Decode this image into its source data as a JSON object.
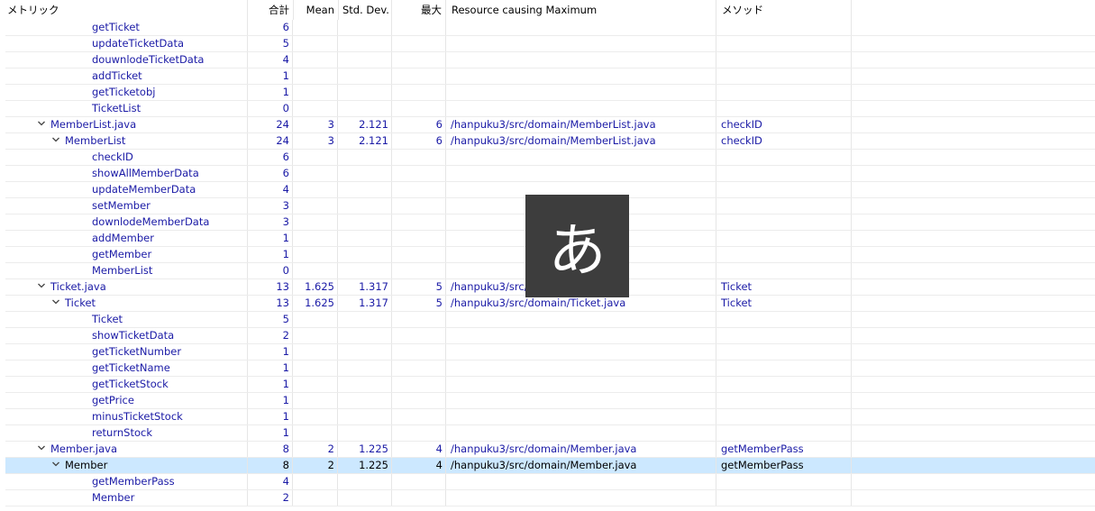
{
  "columns": {
    "metric": "メトリック",
    "total": "合計",
    "mean": "Mean",
    "stddev": "Std. Dev.",
    "max": "最大",
    "resource": "Resource causing Maximum",
    "method": "メソッド"
  },
  "rows": [
    {
      "name": "getTicket",
      "level": 3,
      "total": "6",
      "mean": "",
      "std": "",
      "max": "",
      "res": "",
      "method": "",
      "expand": ""
    },
    {
      "name": "updateTicketData",
      "level": 3,
      "total": "5",
      "mean": "",
      "std": "",
      "max": "",
      "res": "",
      "method": "",
      "expand": ""
    },
    {
      "name": "douwnlodeTicketData",
      "level": 3,
      "total": "4",
      "mean": "",
      "std": "",
      "max": "",
      "res": "",
      "method": "",
      "expand": ""
    },
    {
      "name": "addTicket",
      "level": 3,
      "total": "1",
      "mean": "",
      "std": "",
      "max": "",
      "res": "",
      "method": "",
      "expand": ""
    },
    {
      "name": "getTicketobj",
      "level": 3,
      "total": "1",
      "mean": "",
      "std": "",
      "max": "",
      "res": "",
      "method": "",
      "expand": ""
    },
    {
      "name": "TicketList",
      "level": 3,
      "total": "0",
      "mean": "",
      "std": "",
      "max": "",
      "res": "",
      "method": "",
      "expand": ""
    },
    {
      "name": "MemberList.java",
      "level": 1,
      "total": "24",
      "mean": "3",
      "std": "2.121",
      "max": "6",
      "res": "/hanpuku3/src/domain/MemberList.java",
      "method": "checkID",
      "expand": "open"
    },
    {
      "name": "MemberList",
      "level": 2,
      "total": "24",
      "mean": "3",
      "std": "2.121",
      "max": "6",
      "res": "/hanpuku3/src/domain/MemberList.java",
      "method": "checkID",
      "expand": "open"
    },
    {
      "name": "checkID",
      "level": 3,
      "total": "6",
      "mean": "",
      "std": "",
      "max": "",
      "res": "",
      "method": "",
      "expand": ""
    },
    {
      "name": "showAllMemberData",
      "level": 3,
      "total": "6",
      "mean": "",
      "std": "",
      "max": "",
      "res": "",
      "method": "",
      "expand": ""
    },
    {
      "name": "updateMemberData",
      "level": 3,
      "total": "4",
      "mean": "",
      "std": "",
      "max": "",
      "res": "",
      "method": "",
      "expand": ""
    },
    {
      "name": "setMember",
      "level": 3,
      "total": "3",
      "mean": "",
      "std": "",
      "max": "",
      "res": "",
      "method": "",
      "expand": ""
    },
    {
      "name": "downlodeMemberData",
      "level": 3,
      "total": "3",
      "mean": "",
      "std": "",
      "max": "",
      "res": "",
      "method": "",
      "expand": ""
    },
    {
      "name": "addMember",
      "level": 3,
      "total": "1",
      "mean": "",
      "std": "",
      "max": "",
      "res": "",
      "method": "",
      "expand": ""
    },
    {
      "name": "getMember",
      "level": 3,
      "total": "1",
      "mean": "",
      "std": "",
      "max": "",
      "res": "",
      "method": "",
      "expand": ""
    },
    {
      "name": "MemberList",
      "level": 3,
      "total": "0",
      "mean": "",
      "std": "",
      "max": "",
      "res": "",
      "method": "",
      "expand": ""
    },
    {
      "name": "Ticket.java",
      "level": 1,
      "total": "13",
      "mean": "1.625",
      "std": "1.317",
      "max": "5",
      "res": "/hanpuku3/src/domain/Ticket.java",
      "method": "Ticket",
      "expand": "open"
    },
    {
      "name": "Ticket",
      "level": 2,
      "total": "13",
      "mean": "1.625",
      "std": "1.317",
      "max": "5",
      "res": "/hanpuku3/src/domain/Ticket.java",
      "method": "Ticket",
      "expand": "open"
    },
    {
      "name": "Ticket",
      "level": 3,
      "total": "5",
      "mean": "",
      "std": "",
      "max": "",
      "res": "",
      "method": "",
      "expand": ""
    },
    {
      "name": "showTicketData",
      "level": 3,
      "total": "2",
      "mean": "",
      "std": "",
      "max": "",
      "res": "",
      "method": "",
      "expand": ""
    },
    {
      "name": "getTicketNumber",
      "level": 3,
      "total": "1",
      "mean": "",
      "std": "",
      "max": "",
      "res": "",
      "method": "",
      "expand": ""
    },
    {
      "name": "getTicketName",
      "level": 3,
      "total": "1",
      "mean": "",
      "std": "",
      "max": "",
      "res": "",
      "method": "",
      "expand": ""
    },
    {
      "name": "getTicketStock",
      "level": 3,
      "total": "1",
      "mean": "",
      "std": "",
      "max": "",
      "res": "",
      "method": "",
      "expand": ""
    },
    {
      "name": "getPrice",
      "level": 3,
      "total": "1",
      "mean": "",
      "std": "",
      "max": "",
      "res": "",
      "method": "",
      "expand": ""
    },
    {
      "name": "minusTicketStock",
      "level": 3,
      "total": "1",
      "mean": "",
      "std": "",
      "max": "",
      "res": "",
      "method": "",
      "expand": ""
    },
    {
      "name": "returnStock",
      "level": 3,
      "total": "1",
      "mean": "",
      "std": "",
      "max": "",
      "res": "",
      "method": "",
      "expand": ""
    },
    {
      "name": "Member.java",
      "level": 1,
      "total": "8",
      "mean": "2",
      "std": "1.225",
      "max": "4",
      "res": "/hanpuku3/src/domain/Member.java",
      "method": "getMemberPass",
      "expand": "open"
    },
    {
      "name": "Member",
      "level": 2,
      "total": "8",
      "mean": "2",
      "std": "1.225",
      "max": "4",
      "res": "/hanpuku3/src/domain/Member.java",
      "method": "getMemberPass",
      "expand": "open",
      "selected": true
    },
    {
      "name": "getMemberPass",
      "level": 3,
      "total": "4",
      "mean": "",
      "std": "",
      "max": "",
      "res": "",
      "method": "",
      "expand": ""
    },
    {
      "name": "Member",
      "level": 3,
      "total": "2",
      "mean": "",
      "std": "",
      "max": "",
      "res": "",
      "method": "",
      "expand": ""
    }
  ],
  "ime_indicator": {
    "glyph": "あ"
  },
  "icons": {
    "expand": "chevron-down-icon"
  }
}
